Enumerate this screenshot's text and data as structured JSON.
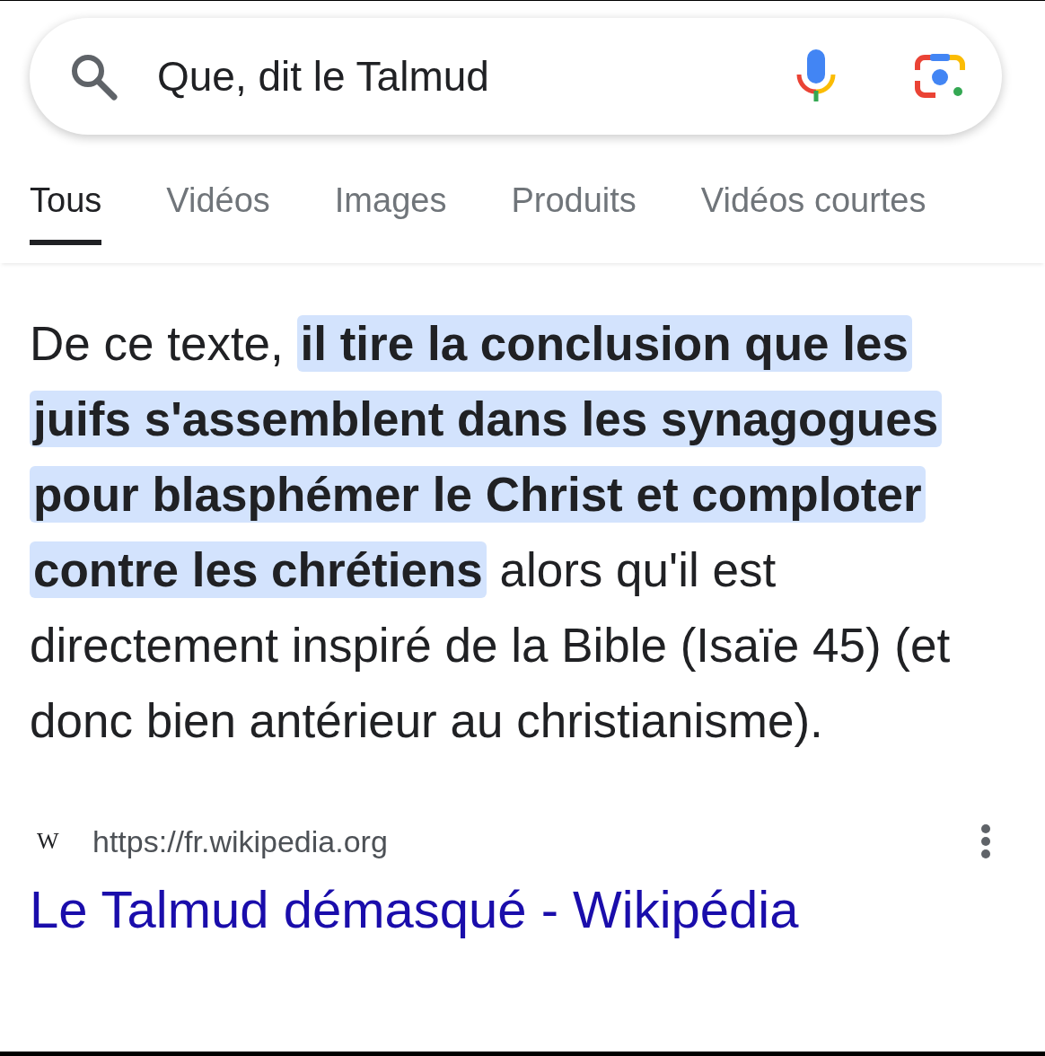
{
  "search": {
    "value": "Que, dit le Talmud"
  },
  "tabs": [
    {
      "label": "Tous",
      "selected": true
    },
    {
      "label": "Vidéos",
      "selected": false
    },
    {
      "label": "Images",
      "selected": false
    },
    {
      "label": "Produits",
      "selected": false
    },
    {
      "label": "Vidéos courtes",
      "selected": false
    }
  ],
  "snippet": {
    "text": "De ce texte, **il tire la conclusion que les juifs s'assemblent dans les synagogues pour blasphémer le Christ et comploter contre les chrétiens** alors qu'il est directement inspiré de la Bible (Isaïe 45) (et donc bien antérieur au christianisme)."
  },
  "source": {
    "favicon": "W",
    "url": "https://fr.wikipedia.org",
    "title": "Le Talmud démasqué - Wikipédia"
  }
}
